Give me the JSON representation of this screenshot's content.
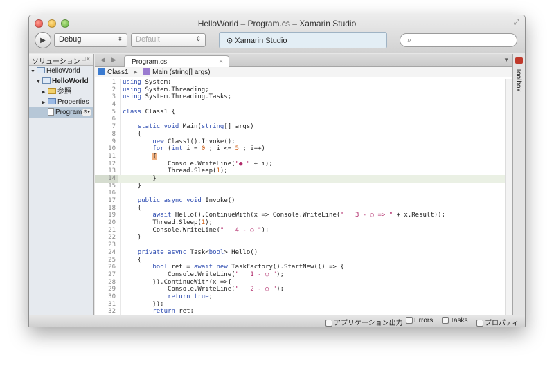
{
  "window": {
    "title": "HelloWorld – Program.cs – Xamarin Studio",
    "fullscreen_icon": "⤢"
  },
  "toolbar": {
    "run_icon": "▶",
    "configuration": "Debug",
    "target": "Default",
    "status_text": "Xamarin Studio",
    "status_icon": "⊙",
    "search_placeholder": "",
    "search_icon": "⌕",
    "combo_arrow": "⇕"
  },
  "solution": {
    "header": "ソリューション",
    "header_controls": "□✕",
    "items": [
      {
        "label": "HelloWorld",
        "bold": false
      },
      {
        "label": "HelloWorld",
        "bold": true
      },
      {
        "label": "参照",
        "bold": false
      },
      {
        "label": "Properties",
        "bold": false
      },
      {
        "label": "Program",
        "bold": false,
        "selected": true
      }
    ]
  },
  "editor": {
    "tab_label": "Program.cs",
    "tab_close": "×",
    "nav_back": "◀",
    "nav_forward": "▶",
    "tab_dropdown": "▼",
    "breadcrumb": {
      "class_name": "Class1",
      "separator": "▸",
      "method_name": "Main (string[] args)"
    },
    "current_line": 14,
    "lines": [
      "using System;",
      "using System.Threading;",
      "using System.Threading.Tasks;",
      "",
      "class Class1 {",
      "",
      "    static void Main(string[] args)",
      "    {",
      "        new Class1().Invoke();",
      "        for (int i = 0 ; i <= 5 ; i++)",
      "        {",
      "            Console.WriteLine(\"● \" + i);",
      "            Thread.Sleep(1);",
      "        }",
      "    }",
      "",
      "    public async void Invoke()",
      "    {",
      "        await Hello().ContinueWith(x => Console.WriteLine(\"   3 - ○ => \" + x.Result));",
      "        Thread.Sleep(1);",
      "        Console.WriteLine(\"   4 - ○ \");",
      "    }",
      "",
      "    private async Task<bool> Hello()",
      "    {",
      "        bool ret = await new TaskFactory().StartNew(() => {",
      "            Console.WriteLine(\"   1 - ○ \");",
      "        }).ContinueWith(x =>{",
      "            Console.WriteLine(\"   2 - ○ \");",
      "            return true;",
      "        });",
      "        return ret;"
    ]
  },
  "toolbox": {
    "label": "Toolbox"
  },
  "statusbar": {
    "items": [
      {
        "icon": "application-output-icon",
        "label": "アプリケーション出力"
      },
      {
        "icon": "errors-icon",
        "label": "Errors"
      },
      {
        "icon": "tasks-icon",
        "label": "Tasks"
      },
      {
        "icon": "properties-icon",
        "label": "プロパティ"
      }
    ]
  },
  "colors": {
    "keyword": "#2b4ab0",
    "string": "#b12a6a",
    "number": "#d06018",
    "current_line": "#eaf0e4"
  }
}
